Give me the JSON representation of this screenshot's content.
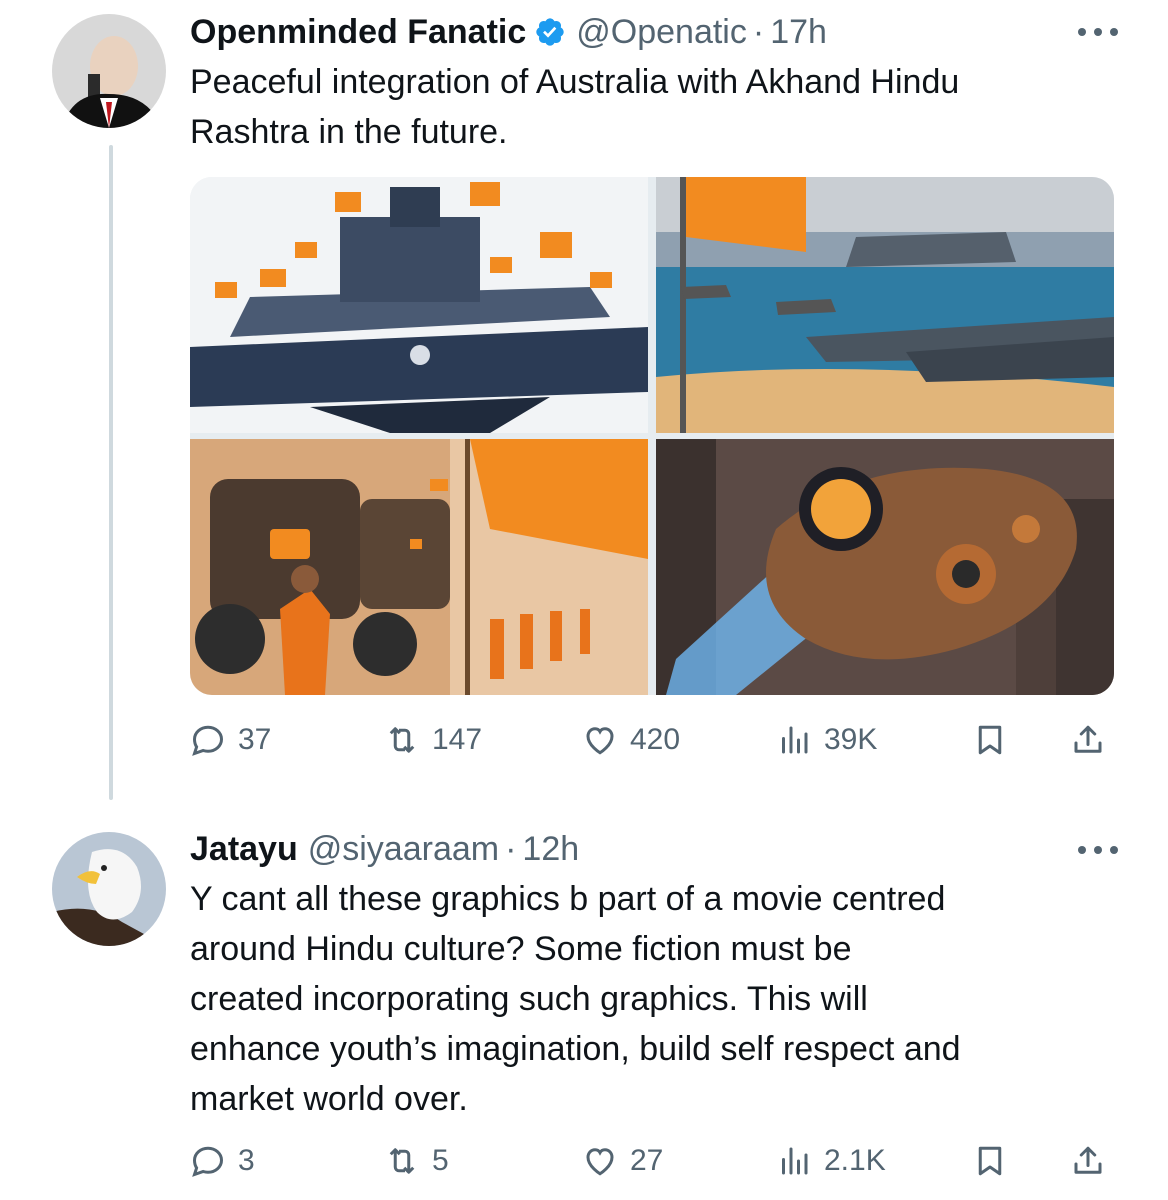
{
  "tweets": [
    {
      "name": "Openminded Fanatic",
      "verified": true,
      "handle": "@Openatic",
      "separator": "·",
      "time": "17h",
      "text_lines": [
        "Peaceful integration of Australia with Akhand Hindu",
        "Rashtra in the future."
      ],
      "media_count": 4,
      "stats": {
        "replies": "37",
        "reposts": "147",
        "likes": "420",
        "views": "39K"
      }
    },
    {
      "name": "Jatayu",
      "verified": false,
      "handle": "@siyaaraam",
      "separator": "·",
      "time": "12h",
      "text_lines": [
        "Y cant all these graphics b part of a movie centred",
        "around Hindu culture?  Some fiction must be",
        "created incorporating such graphics. This will",
        "enhance youth’s imagination, build self respect and",
        "market world over."
      ],
      "stats": {
        "replies": "3",
        "reposts": "5",
        "likes": "27",
        "views": "2.1K"
      }
    }
  ],
  "colors": {
    "accent": "#1d9bf0",
    "secondary_text": "#536471",
    "saffron": "#f28b20",
    "thread_line": "#cfd9de"
  },
  "icons": [
    "reply-icon",
    "repost-icon",
    "like-icon",
    "views-icon",
    "bookmark-icon",
    "share-icon",
    "verified-icon",
    "more-icon"
  ]
}
